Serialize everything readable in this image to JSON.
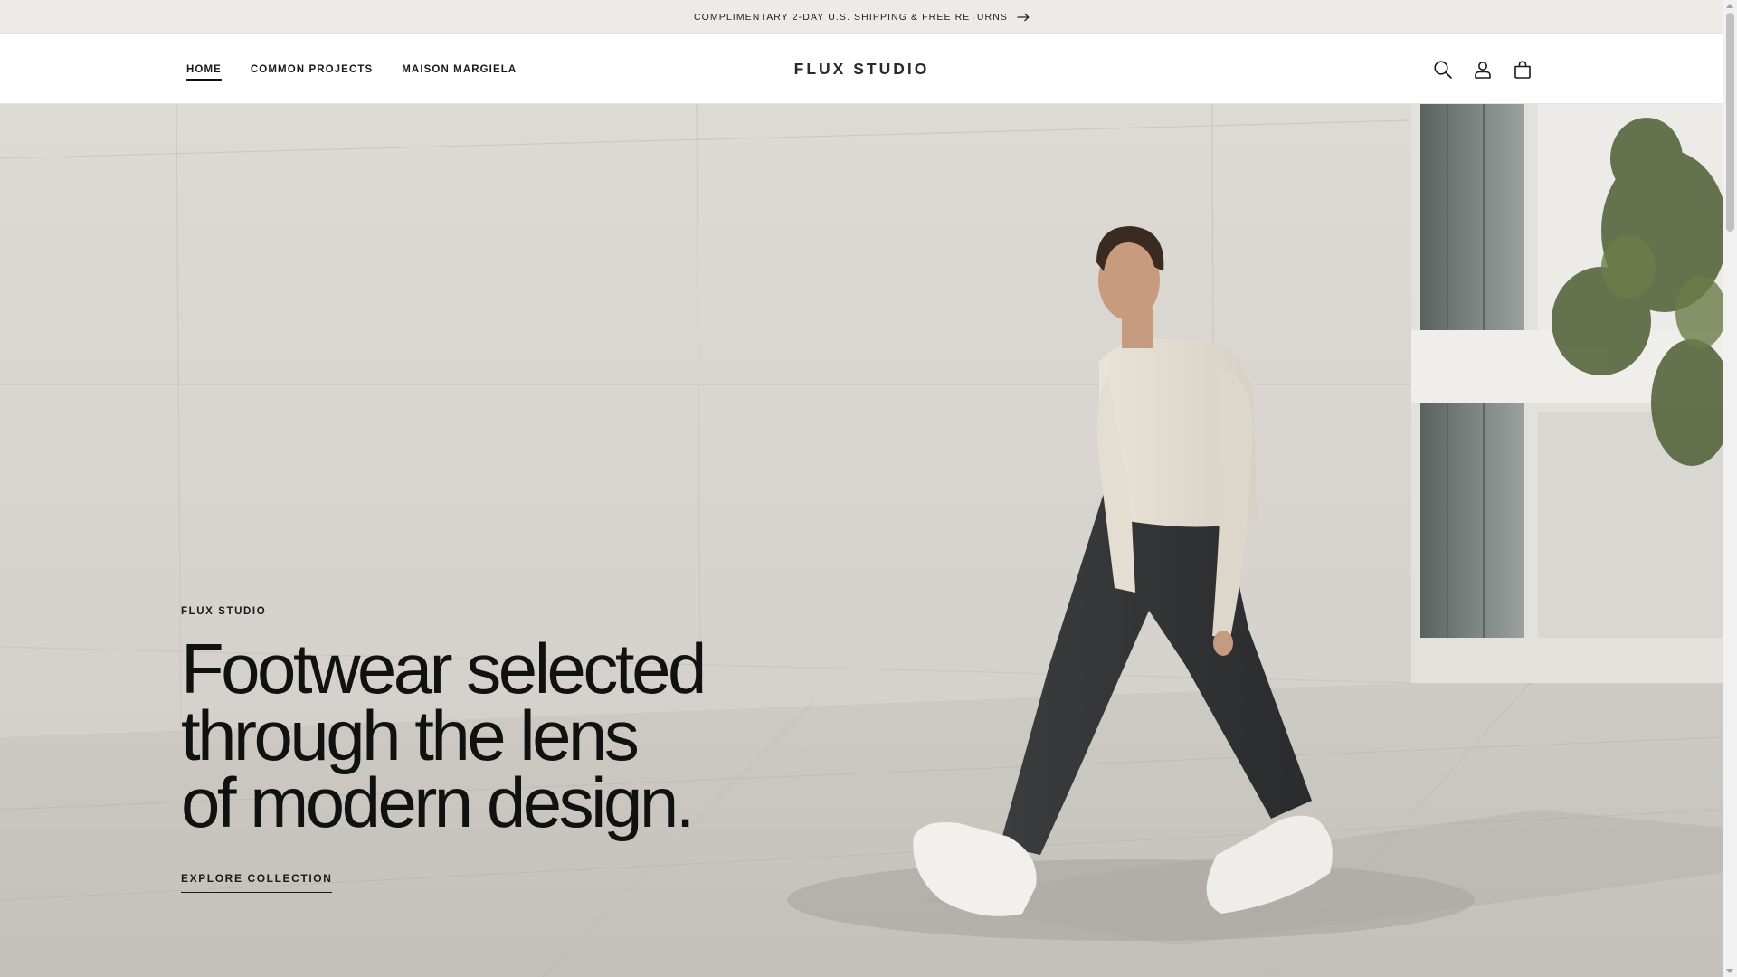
{
  "announcement": {
    "text": "COMPLIMENTARY 2-DAY U.S. SHIPPING & FREE RETURNS",
    "icon": "arrow-right-icon"
  },
  "header": {
    "nav": [
      {
        "label": "HOME",
        "active": true
      },
      {
        "label": "COMMON PROJECTS",
        "active": false
      },
      {
        "label": "MAISON MARGIELA",
        "active": false
      }
    ],
    "logo": "FLUX STUDIO",
    "icons": [
      "search-icon",
      "account-icon",
      "cart-icon"
    ]
  },
  "hero": {
    "eyebrow": "FLUX STUDIO",
    "headline": [
      "Footwear selected",
      "through the lens",
      "of modern design."
    ],
    "cta": "EXPLORE COLLECTION"
  },
  "colors": {
    "announcement_bg": "#ecebe8",
    "text": "#121212",
    "hero_bg": "#dcd9d4"
  }
}
